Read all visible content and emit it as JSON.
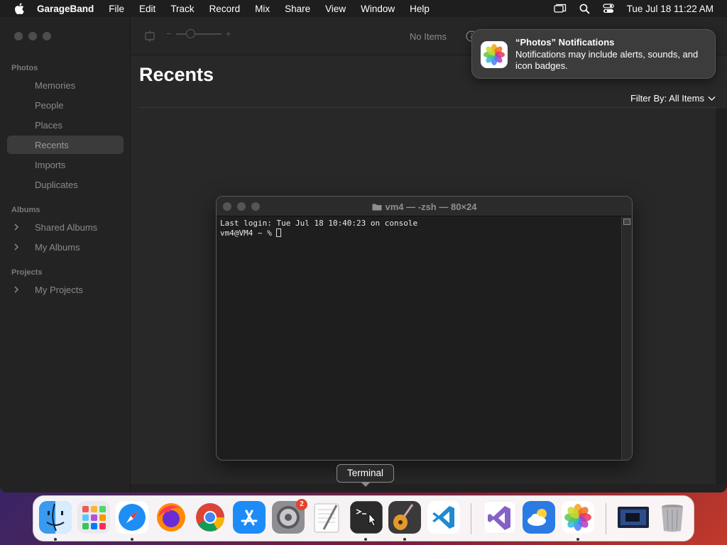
{
  "menubar": {
    "app_name": "GarageBand",
    "items": [
      "File",
      "Edit",
      "Track",
      "Record",
      "Mix",
      "Share",
      "View",
      "Window",
      "Help"
    ],
    "clock": "Tue Jul 18  11:22 AM"
  },
  "photos": {
    "sidebar": {
      "photos_heading": "Photos",
      "photos_items": [
        "Memories",
        "People",
        "Places",
        "Recents",
        "Imports",
        "Duplicates"
      ],
      "selected": "Recents",
      "albums_heading": "Albums",
      "album_items": [
        "Shared Albums",
        "My Albums"
      ],
      "projects_heading": "Projects",
      "project_items": [
        "My Projects"
      ]
    },
    "toolbar": {
      "zoom_minus": "−",
      "zoom_plus": "+",
      "no_items": "No Items"
    },
    "content": {
      "title": "Recents",
      "filter_label": "Filter By: All Items"
    }
  },
  "notification": {
    "title": "“Photos” Notifications",
    "body": "Notifications may include alerts, sounds, and icon badges."
  },
  "terminal": {
    "title": "vm4 — -zsh — 80×24",
    "line1": "Last login: Tue Jul 18 10:40:23 on console",
    "prompt": "vm4@VM4 ~ % "
  },
  "dock": {
    "tooltip": "Terminal",
    "settings_badge": "2",
    "apps": [
      "Finder",
      "Launchpad",
      "Safari",
      "Firefox",
      "Chrome",
      "App Store",
      "System Settings",
      "TextEdit",
      "Terminal",
      "GarageBand",
      "Visual Studio Code",
      "Visual Studio",
      "Weather",
      "Photos",
      "Screenshot",
      "Trash"
    ]
  },
  "colors": {
    "accent_badge": "#e5412d",
    "terminal_bg": "#1e1e1e",
    "window_bg": "#282828"
  }
}
